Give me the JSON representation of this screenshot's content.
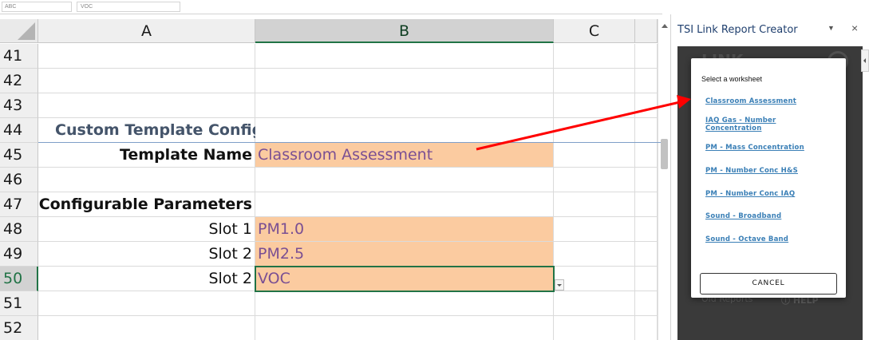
{
  "formula_bar": {
    "name_box": "ABC",
    "formula": "VOC"
  },
  "columns": [
    {
      "label": "A",
      "selected": false
    },
    {
      "label": "B",
      "selected": true
    },
    {
      "label": "C",
      "selected": false
    }
  ],
  "rows": [
    {
      "num": "41",
      "a": "",
      "b": "",
      "a_style": "",
      "b_style": ""
    },
    {
      "num": "42",
      "a": "",
      "b": "",
      "a_style": "",
      "b_style": ""
    },
    {
      "num": "43",
      "a": "",
      "b": "",
      "a_style": "",
      "b_style": ""
    },
    {
      "num": "44",
      "a": "Custom Template Configuration",
      "b": "",
      "a_style": "section",
      "b_style": ""
    },
    {
      "num": "45",
      "a": "Template Name",
      "b": "Classroom Assessment",
      "a_style": "bold-right",
      "b_style": "orange"
    },
    {
      "num": "46",
      "a": "",
      "b": "",
      "a_style": "",
      "b_style": ""
    },
    {
      "num": "47",
      "a": "Configurable Parameters",
      "b": "",
      "a_style": "bold-right",
      "b_style": ""
    },
    {
      "num": "48",
      "a": "Slot 1",
      "b": "PM1.0",
      "a_style": "right",
      "b_style": "orange"
    },
    {
      "num": "49",
      "a": "Slot 2",
      "b": "PM2.5",
      "a_style": "right",
      "b_style": "orange"
    },
    {
      "num": "50",
      "a": "Slot 2",
      "b": "VOC",
      "a_style": "right",
      "b_style": "orange-active"
    },
    {
      "num": "51",
      "a": "",
      "b": "",
      "a_style": "",
      "b_style": ""
    },
    {
      "num": "52",
      "a": "",
      "b": "",
      "a_style": "",
      "b_style": ""
    }
  ],
  "active_row": "50",
  "task_pane": {
    "title": "TSI Link Report Creator",
    "menu_icon": "chevron-down-icon",
    "close_icon": "close-icon",
    "close_glyph": "×",
    "menu_glyph": "▼",
    "background_logo": "LINK",
    "background_left": "Old Reports",
    "background_help": "ⓘ HELP"
  },
  "dialog": {
    "title": "Select a worksheet",
    "options": [
      "Classroom Assessment",
      "IAQ Gas - Number Concentration",
      "PM - Mass Concentration",
      "PM - Number Conc H&S",
      "PM - Number Conc IAQ",
      "Sound - Broadband",
      "Sound - Octave Band"
    ],
    "cancel_label": "CANCEL"
  },
  "colors": {
    "accent_green": "#217346",
    "orange_fill": "#fbcba0",
    "value_text": "#7a4f93",
    "section_title": "#44546a",
    "link_blue": "#3a7fb6",
    "arrow_red": "#ff0000"
  }
}
